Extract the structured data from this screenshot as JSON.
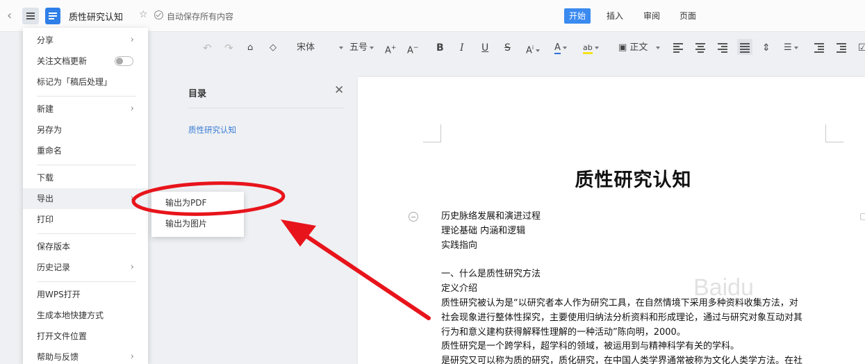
{
  "topbar": {
    "doc_title": "质性研究认知",
    "autosave_text": "自动保存所有内容",
    "tabs": [
      {
        "label": "开始",
        "active": true
      },
      {
        "label": "插入",
        "active": false
      },
      {
        "label": "审阅",
        "active": false
      },
      {
        "label": "页面",
        "active": false
      }
    ]
  },
  "toolbar": {
    "font_name": "宋体",
    "font_size": "五号",
    "paragraph_style": "正文"
  },
  "menu": {
    "items": [
      {
        "label": "分享",
        "has_submenu": true
      },
      {
        "label": "关注文档更新",
        "toggle": false
      },
      {
        "label": "标记为「稿后处理」"
      },
      {
        "label": "新建",
        "has_submenu": true
      },
      {
        "label": "另存为"
      },
      {
        "label": "重命名"
      },
      {
        "label": "下载"
      },
      {
        "label": "导出",
        "has_submenu": true,
        "hovered": true
      },
      {
        "label": "打印"
      },
      {
        "label": "保存版本"
      },
      {
        "label": "历史记录",
        "has_submenu": true
      },
      {
        "label": "用WPS打开"
      },
      {
        "label": "生成本地快捷方式"
      },
      {
        "label": "打开文件位置"
      },
      {
        "label": "帮助与反馈",
        "has_submenu": true
      }
    ]
  },
  "submenu": {
    "items": [
      {
        "label": "输出为PDF"
      },
      {
        "label": "输出为图片"
      }
    ]
  },
  "toc": {
    "title": "目录",
    "items": [
      "质性研究认知"
    ]
  },
  "document": {
    "title": "质性研究认知",
    "lines": [
      "历史脉络发展和演进过程",
      "理论基础  内涵和逻辑",
      "实践指向",
      "",
      "一、什么是质性研究方法",
      "定义介绍",
      "质性研究被认为是“以研究者本人作为研究工具，在自然情境下采用多种资料收集方法，对",
      "社会现象进行整体性探究，主要使用归纳法分析资料和形成理论，通过与研究对象互动对其",
      "行为和意义建构获得解释性理解的一种活动”陈向明，2000。",
      "质性研究是一个跨学科，超学科的领域，被运用到与精神科学有关的学科。",
      "是研究又可以称为质的研究，质化研究，在中国人类学界通常被称为文化人类学方法。在社"
    ]
  },
  "annotation": {
    "color": "#e8141b"
  },
  "watermark": "Baidu"
}
